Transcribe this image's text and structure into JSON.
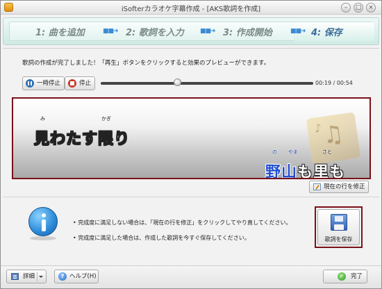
{
  "window": {
    "title": "iSofterカラオケ字幕作成 - [AKS歌詞を作成]",
    "controls": {
      "minimize": "–",
      "maximize": "□",
      "close": "×"
    }
  },
  "steps": [
    {
      "label": "1: 曲を追加",
      "active": false
    },
    {
      "label": "2: 歌詞を入力",
      "active": false
    },
    {
      "label": "3: 作成開始",
      "active": false
    },
    {
      "label": "4: 保存",
      "active": true
    }
  ],
  "step_arrow": "■■➜",
  "message": "歌詞の作成が完了しました！「再生」ボタンをクリックすると効果のプレビューができます。",
  "player": {
    "pause_label": "一時停止",
    "stop_label": "停止",
    "progress_fraction": 0.36,
    "time_display": "00:19 / 00:54"
  },
  "preview": {
    "line1": {
      "text": "見わたす限り",
      "ruby": [
        {
          "text": "み"
        },
        {
          "text": "かぎ"
        }
      ]
    },
    "line2": {
      "sung": "野山",
      "unsung": "も里も",
      "ruby": [
        {
          "text": "の"
        },
        {
          "text": "やま"
        },
        {
          "text": "さと"
        }
      ]
    },
    "art_icon": "music-note-icon"
  },
  "modify_button": "現在の行を修正",
  "info": {
    "bullets": [
      "完成度に満足しない場合は、「現在の行を修正」をクリックしてやり直してください。",
      "完成度に満足した場合は、作成した歌詞を今すぐ保存してください。"
    ]
  },
  "save_button": "歌詞を保存",
  "bottom": {
    "details_label": "詳細",
    "help_label": "ヘルプ(H)",
    "finish_label": "完了"
  },
  "colors": {
    "highlight_border": "#7b1018",
    "sung_lyric": "#1f4fd0",
    "step_active": "#3b6e9b"
  }
}
